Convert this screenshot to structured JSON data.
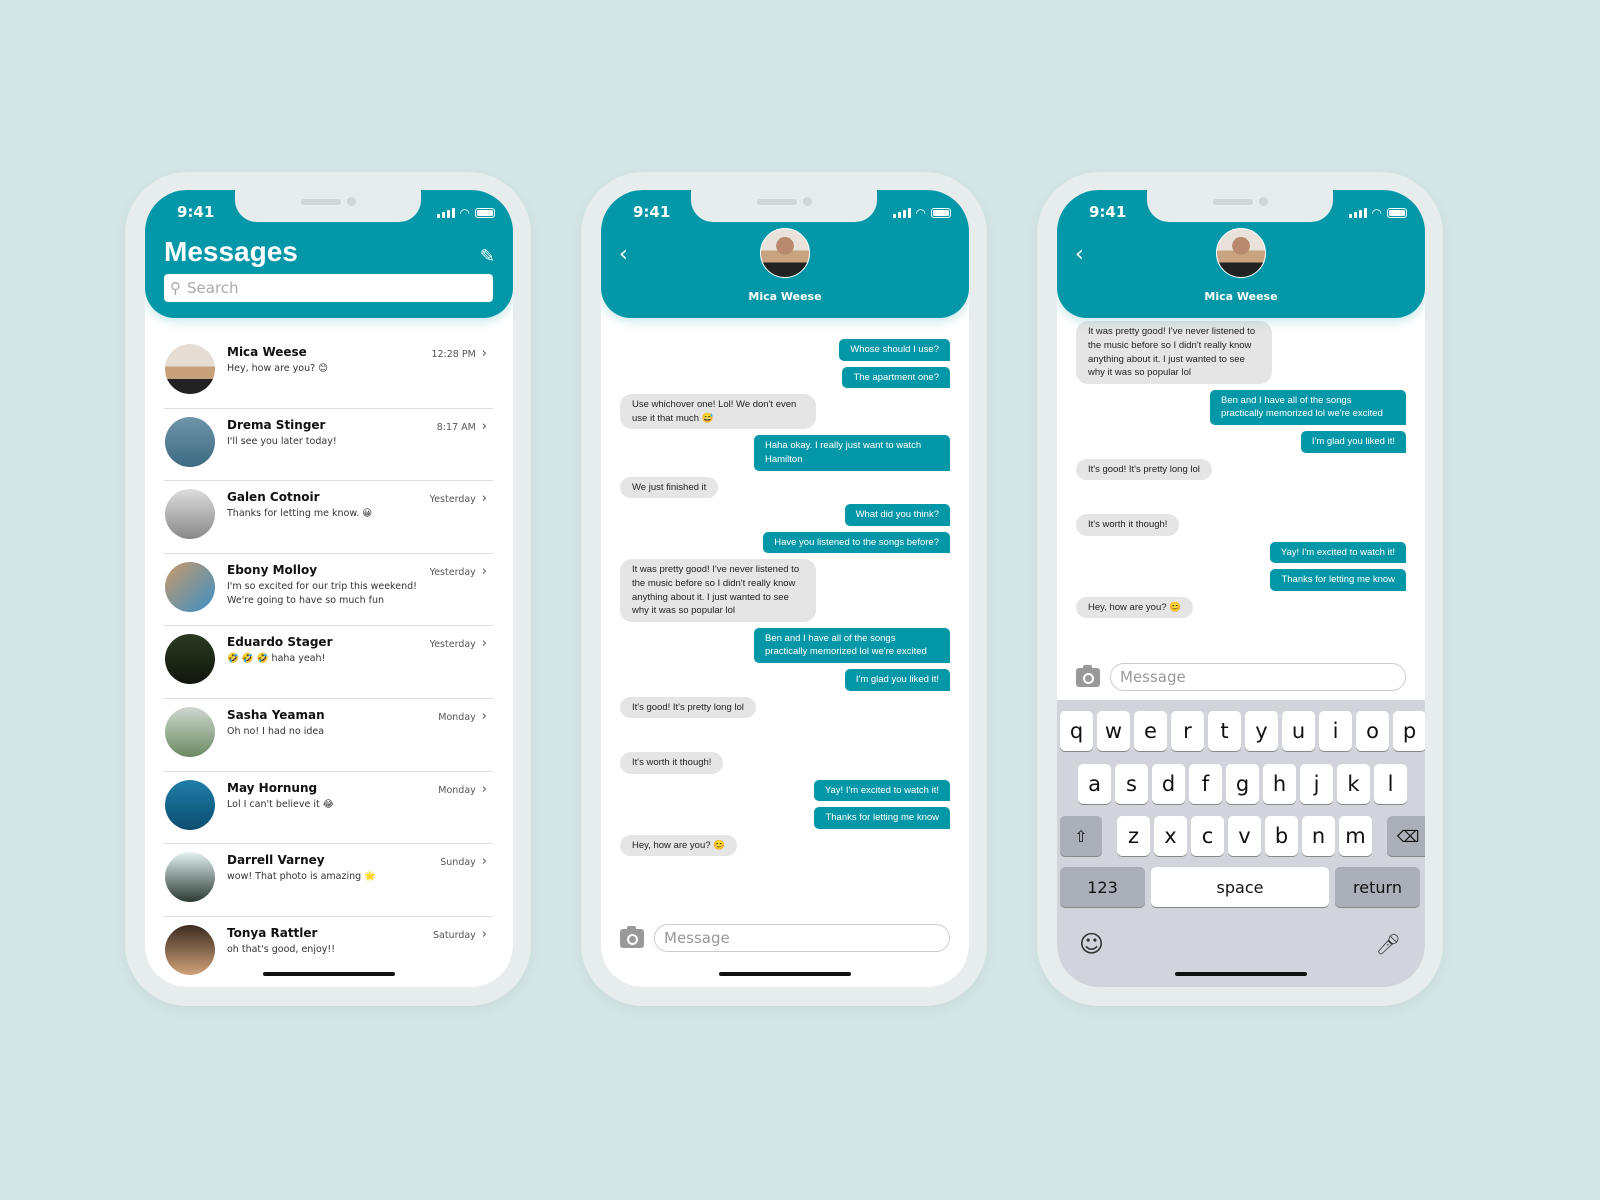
{
  "colors": {
    "accent": "#0497a7",
    "background": "#d4e5e6"
  },
  "status": {
    "time": "9:41"
  },
  "list_screen": {
    "title": "Messages",
    "search_placeholder": "Search",
    "contacts": [
      {
        "name": "Mica Weese",
        "preview": "Hey, how are you? 😊",
        "time": "12:28 PM"
      },
      {
        "name": "Drema Stinger",
        "preview": "I'll see you later today!",
        "time": "8:17 AM"
      },
      {
        "name": "Galen Cotnoir",
        "preview": "Thanks for letting me know. 😀",
        "time": "Yesterday"
      },
      {
        "name": "Ebony Molloy",
        "preview": "I'm so excited for our trip this weekend! We're going to have so much fun",
        "time": "Yesterday"
      },
      {
        "name": "Eduardo Stager",
        "preview": "🤣 🤣 🤣  haha yeah!",
        "time": "Yesterday"
      },
      {
        "name": "Sasha Yeaman",
        "preview": "Oh no! I had no idea",
        "time": "Monday"
      },
      {
        "name": "May Hornung",
        "preview": "Lol I can't believe it 😂",
        "time": "Monday"
      },
      {
        "name": "Darrell Varney",
        "preview": "wow! That photo is amazing 🌟",
        "time": "Sunday"
      },
      {
        "name": "Tonya Rattler",
        "preview": "oh that's good, enjoy!!",
        "time": "Saturday"
      }
    ]
  },
  "chat_screen": {
    "contact_name": "Mica Weese",
    "message_placeholder": "Message",
    "messages": [
      {
        "from": "me",
        "text": "Whose should I use?"
      },
      {
        "from": "me",
        "text": "The apartment one?"
      },
      {
        "from": "them",
        "text": "Use whichover one! Lol! We don't even use it that much 😅"
      },
      {
        "from": "me",
        "text": "Haha okay. I really just want to watch Hamilton"
      },
      {
        "from": "them",
        "text": "We just finished it"
      },
      {
        "from": "me",
        "text": "What did you think?"
      },
      {
        "from": "me",
        "text": "Have you listened to the songs before?"
      },
      {
        "from": "them",
        "text": "It was pretty good! I've never listened to the music before so I didn't really know anything about it. I just wanted to see why it was so popular lol"
      },
      {
        "from": "me",
        "text": "Ben and I have all of the songs practically memorized lol we're excited"
      },
      {
        "from": "me",
        "text": "I'm glad you liked it!"
      },
      {
        "from": "them",
        "text": "It's good! It's pretty long lol"
      },
      {
        "from": "them",
        "text": "It's worth it though!"
      },
      {
        "from": "me",
        "text": "Yay! I'm excited to watch it!"
      },
      {
        "from": "me",
        "text": "Thanks for letting me know"
      },
      {
        "from": "them",
        "text": "Hey, how are you? 😊"
      }
    ]
  },
  "keyboard": {
    "row1": [
      "q",
      "w",
      "e",
      "r",
      "t",
      "y",
      "u",
      "i",
      "o",
      "p"
    ],
    "row2": [
      "a",
      "s",
      "d",
      "f",
      "g",
      "h",
      "j",
      "k",
      "l"
    ],
    "row3": [
      "z",
      "x",
      "c",
      "v",
      "b",
      "n",
      "m"
    ],
    "numbers": "123",
    "space": "space",
    "return": "return"
  }
}
